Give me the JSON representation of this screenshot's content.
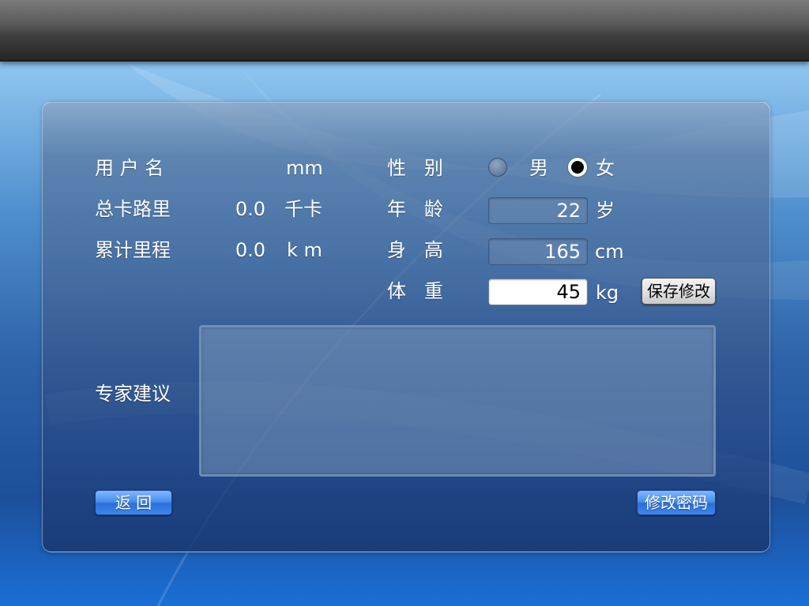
{
  "profile": {
    "username_label": "用 户 名",
    "username_value": "",
    "username_unit": "mm",
    "calories_label": "总卡路里",
    "calories_value": "0.0",
    "calories_unit": "千卡",
    "distance_label": "累计里程",
    "distance_value": "0.0",
    "distance_unit": "k m"
  },
  "body": {
    "gender_label": "性   别",
    "gender_male": "男",
    "gender_female": "女",
    "gender_selected": "女",
    "age_label": "年   龄",
    "age_value": "22",
    "age_unit": "岁",
    "height_label": "身   高",
    "height_value": "165",
    "height_unit": "cm",
    "weight_label": "体   重",
    "weight_value": "45",
    "weight_unit": "kg",
    "save_button": "保存修改"
  },
  "advice": {
    "label": "专家建议",
    "text": ""
  },
  "footer": {
    "back_button": "返  回",
    "change_password_button": "修改密码"
  },
  "colors": {
    "accent_button": "#3d86ee",
    "top_bar": "#3e3e3e",
    "panel": "#46648f"
  }
}
